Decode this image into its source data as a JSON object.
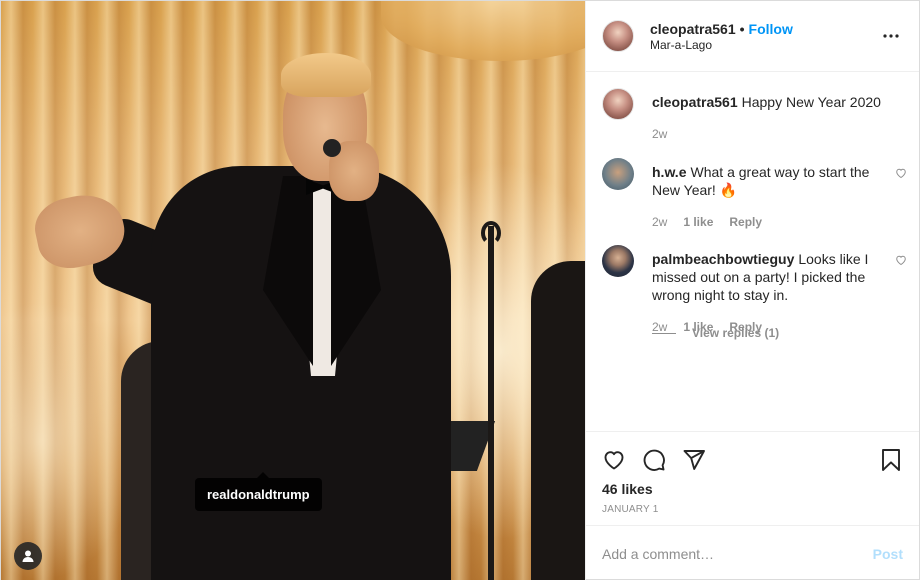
{
  "post": {
    "author": "cleopatra561",
    "location": "Mar-a-Lago",
    "follow_label": "Follow",
    "separator": "•",
    "more_icon": "more-options-icon"
  },
  "media": {
    "tag_label": "realdonaldtrump",
    "tag_badge_icon": "user-tag-icon"
  },
  "caption": {
    "username": "cleopatra561",
    "text": "Happy New Year 2020",
    "time": "2w"
  },
  "comments": [
    {
      "username": "h.w.e",
      "text": "What a great way to start the New Year! 🔥",
      "time": "2w",
      "likes": "1 like",
      "reply": "Reply"
    },
    {
      "username": "palmbeachbowtieguy",
      "text": "Looks like I missed out on a party! I picked the wrong night to stay in.",
      "time": "2w",
      "likes": "1 like",
      "reply": "Reply"
    }
  ],
  "view_replies": "View replies (1)",
  "actions": {
    "likes": "46 likes",
    "date": "JANUARY 1"
  },
  "add_comment": {
    "placeholder": "Add a comment…",
    "post_label": "Post"
  },
  "colors": {
    "link_blue": "#0095f6",
    "post_disabled": "#b2dffc",
    "muted": "#8e8e8e"
  }
}
